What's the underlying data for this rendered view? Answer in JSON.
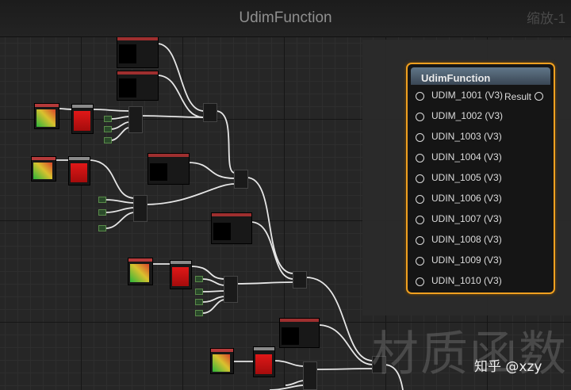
{
  "window": {
    "title": "UdimFunction",
    "zoom_label": "缩放-1"
  },
  "udim_node": {
    "title": "UdimFunction",
    "output_label": "Result",
    "inputs": [
      "UDIM_1001 (V3)",
      "UDIM_1002 (V3)",
      "UDIN_1003 (V3)",
      "UDIN_1004 (V3)",
      "UDIN_1005 (V3)",
      "UDIN_1006 (V3)",
      "UDIN_1007 (V3)",
      "UDIN_1008 (V3)",
      "UDIN_1009 (V3)",
      "UDIN_1010 (V3)"
    ]
  },
  "watermark": {
    "text": "材质函数",
    "credit": "知乎 @xzy"
  },
  "colors": {
    "accent": "#f0a020",
    "background": "#262626"
  }
}
